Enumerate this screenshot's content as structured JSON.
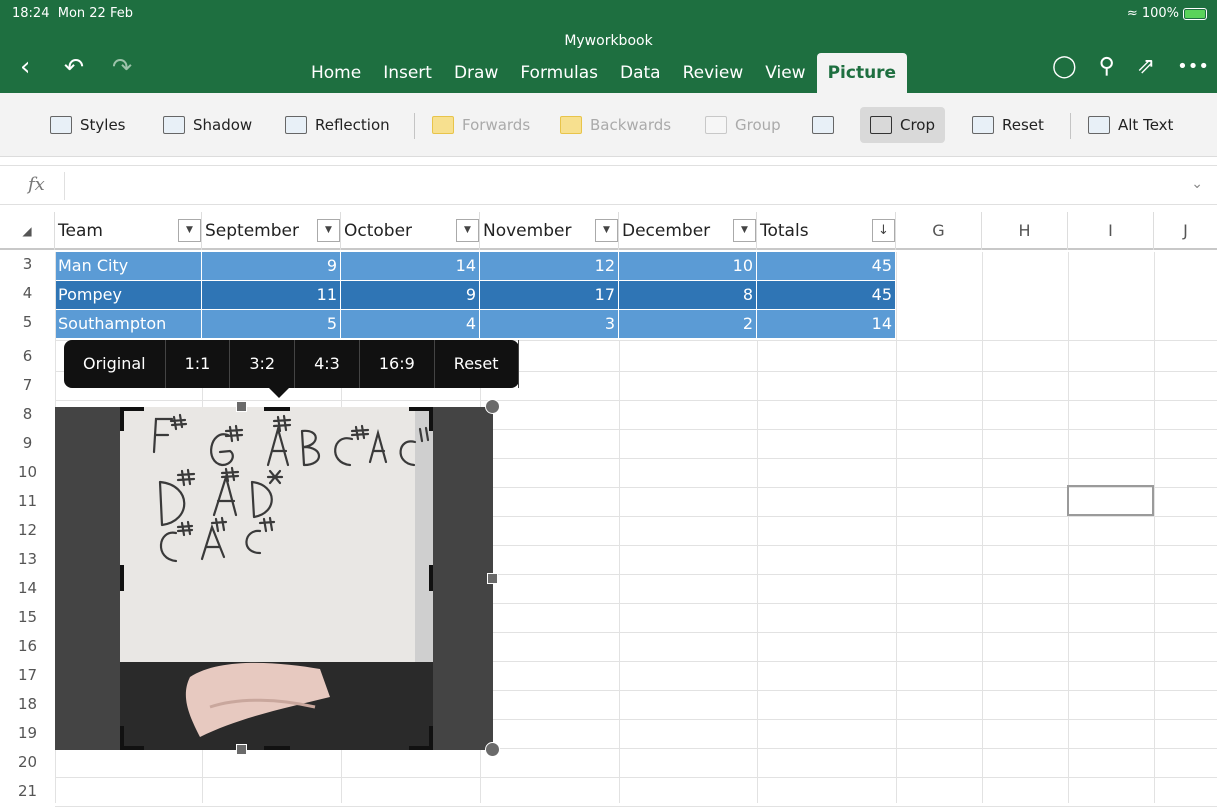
{
  "status": {
    "time": "18:24",
    "date": "Mon 22 Feb",
    "battery": "100%"
  },
  "doc_title": "Myworkbook",
  "tabs": [
    "Home",
    "Insert",
    "Draw",
    "Formulas",
    "Data",
    "Review",
    "View",
    "Picture"
  ],
  "active_tab": "Picture",
  "ribbon": {
    "styles": "Styles",
    "shadow": "Shadow",
    "reflection": "Reflection",
    "forwards": "Forwards",
    "backwards": "Backwards",
    "group": "Group",
    "crop": "Crop",
    "reset": "Reset",
    "alt_text": "Alt Text"
  },
  "formula_bar": {
    "fx": "fx",
    "value": ""
  },
  "table": {
    "headers": [
      "Team",
      "September",
      "October",
      "November",
      "December",
      "Totals"
    ],
    "extra_columns": [
      "G",
      "H",
      "I",
      "J"
    ],
    "rows": [
      {
        "num": "3",
        "cells": [
          "Man City",
          "9",
          "14",
          "12",
          "10",
          "45"
        ]
      },
      {
        "num": "4",
        "cells": [
          "Pompey",
          "11",
          "9",
          "17",
          "8",
          "45"
        ]
      },
      {
        "num": "5",
        "cells": [
          "Southampton",
          "5",
          "4",
          "3",
          "2",
          "14"
        ]
      }
    ],
    "empty_rows": [
      "6",
      "7",
      "8",
      "9",
      "10",
      "11",
      "12",
      "13",
      "14",
      "15",
      "16",
      "17",
      "18",
      "19",
      "20",
      "21"
    ]
  },
  "crop_menu": [
    "Original",
    "1:1",
    "3:2",
    "4:3",
    "16:9",
    "Reset"
  ],
  "colors": {
    "brand": "#1e6f40",
    "table_light": "#5b9bd5",
    "table_dark": "#2f75b5"
  }
}
